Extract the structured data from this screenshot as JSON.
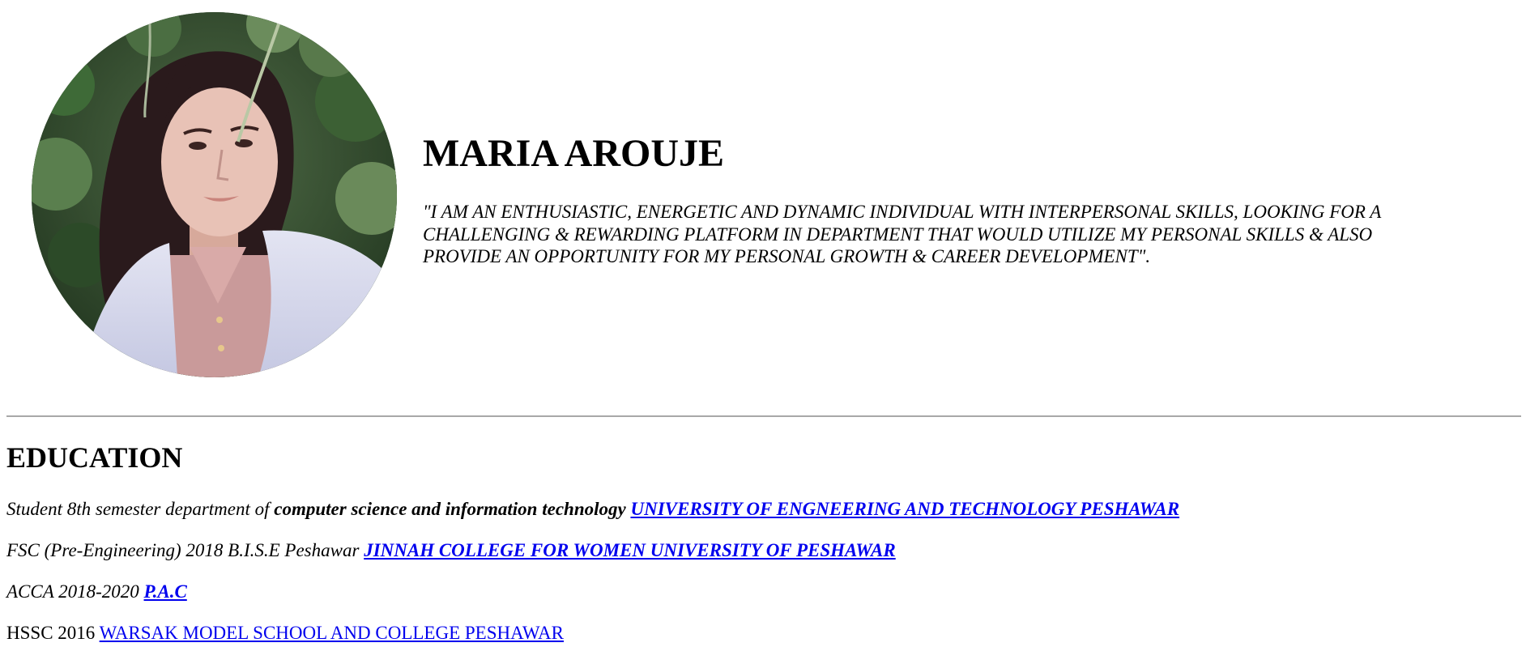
{
  "profile": {
    "name": "MARIA AROUJE",
    "quote": "\"I AM AN ENTHUSIASTIC, ENERGETIC AND DYNAMIC INDIVIDUAL WITH INTERPERSONAL SKILLS, LOOKING FOR A CHALLENGING & REWARDING PLATFORM IN DEPARTMENT THAT WOULD UTILIZE MY PERSONAL SKILLS & ALSO PROVIDE AN OPPORTUNITY FOR MY PERSONAL GROWTH & CAREER DEVELOPMENT\".",
    "photo_icon": "profile-photo"
  },
  "education": {
    "title": "EDUCATION",
    "items": [
      {
        "prefix": "Student 8th semester department of ",
        "bold": "computer science and information technology",
        "link": "UNIVERSITY OF ENGNEERING AND TECHNOLOGY PESHAWAR"
      },
      {
        "prefix": "FSC (Pre-Engineering) 2018 B.I.S.E Peshawar ",
        "link": "JINNAH COLLEGE FOR WOMEN UNIVERSITY OF PESHAWAR"
      },
      {
        "prefix": "ACCA 2018-2020 ",
        "link": "P.A.C"
      },
      {
        "prefix": "HSSC 2016 ",
        "link": "WARSAK MODEL SCHOOL AND COLLEGE PESHAWAR"
      }
    ]
  },
  "colors": {
    "link": "#0000ee",
    "divider": "#a8a8a8",
    "text": "#000000",
    "background": "#ffffff"
  }
}
